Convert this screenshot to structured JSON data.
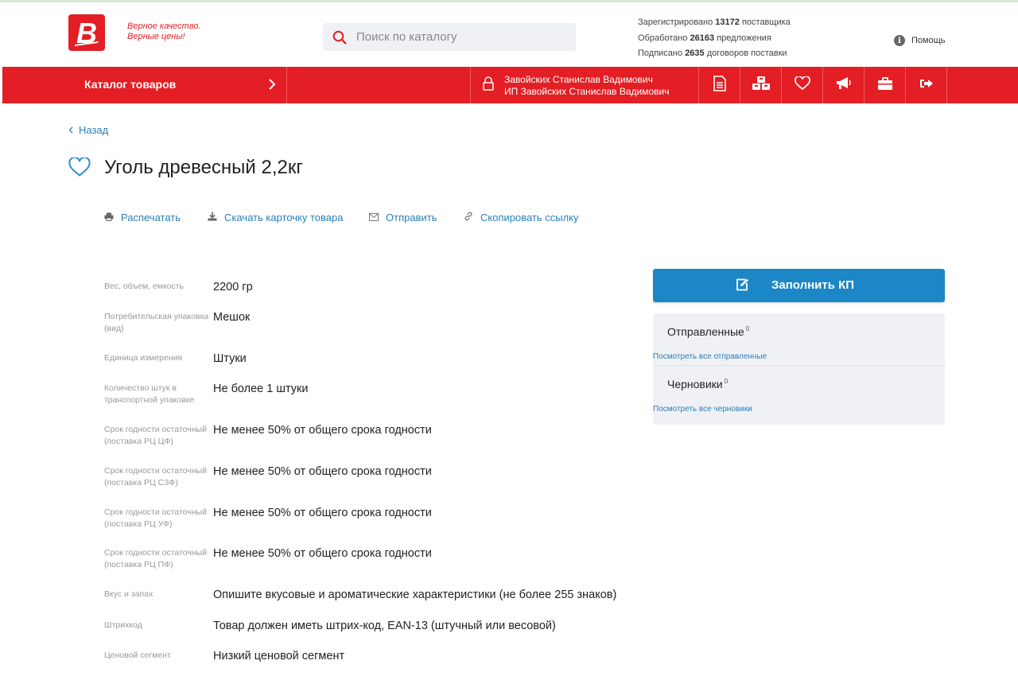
{
  "header": {
    "logo_letter": "B",
    "slogan_line1": "Верное качество.",
    "slogan_line2": "Верные цены!",
    "search": {
      "placeholder": "Поиск по каталогу"
    },
    "stats": {
      "line1_prefix": "Зарегистрировано",
      "line1_value": "13172",
      "line1_suffix": "поставщика",
      "line2_prefix": "Обработано",
      "line2_value": "26163",
      "line2_suffix": "предложения",
      "line3_prefix": "Подписано",
      "line3_value": "2635",
      "line3_suffix": "договоров поставки"
    },
    "help_label": "Помощь",
    "help_icon": "info-icon"
  },
  "navbar": {
    "catalog_label": "Каталог товаров",
    "user_name": "Завойских Станислав Вадимович",
    "user_company": "ИП Завойских Станислав Вадимович",
    "icons": [
      "document-icon",
      "boxes-icon",
      "heart-icon",
      "megaphone-icon",
      "briefcase-icon",
      "logout-icon"
    ]
  },
  "page": {
    "back_label": "Назад",
    "title": "Уголь древесный 2,2кг",
    "actions": {
      "print": "Распечатать",
      "download": "Скачать карточку товара",
      "send": "Отправить",
      "copy_link": "Скопировать ссылку"
    },
    "properties": [
      {
        "label": "Вес, объем, емкость",
        "value": "2200 гр"
      },
      {
        "label": "Потребительская упаковка (вид)",
        "value": "Мешок"
      },
      {
        "label": "Единица измерения",
        "value": "Штуки"
      },
      {
        "label": "Количество штук в транспортной упаковке",
        "value": "Не более 1 штуки"
      },
      {
        "label": "Срок годности остаточный (поставка РЦ ЦФ)",
        "value": "Не менее 50% от общего срока годности"
      },
      {
        "label": "Срок годности остаточный (поставка РЦ СЗФ)",
        "value": "Не менее 50% от общего срока годности"
      },
      {
        "label": "Срок годности остаточный (поставка РЦ УФ)",
        "value": "Не менее 50% от общего срока годности"
      },
      {
        "label": "Срок годности остаточный (поставка РЦ ПФ)",
        "value": "Не менее 50% от общего срока годности"
      },
      {
        "label": "Вкус и запах",
        "value": "Опишите вкусовые и ароматические характеристики (не более 255 знаков)"
      },
      {
        "label": "Штрихкод",
        "value": "Товар должен иметь штрих-код, EAN-13 (штучный или весовой)"
      },
      {
        "label": "Ценовой сегмент",
        "value": "Низкий ценовой сегмент"
      }
    ]
  },
  "sidebar": {
    "fill_kp_label": "Заполнить КП",
    "sent": {
      "title": "Отправленные",
      "count": "0",
      "link": "Посмотреть все отправленные"
    },
    "drafts": {
      "title": "Черновики",
      "count": "0",
      "link": "Посмотреть все черновики"
    }
  },
  "colors": {
    "brand_red": "#e31e24",
    "accent_blue": "#1b87c6",
    "link_blue": "#2a7fb8"
  }
}
